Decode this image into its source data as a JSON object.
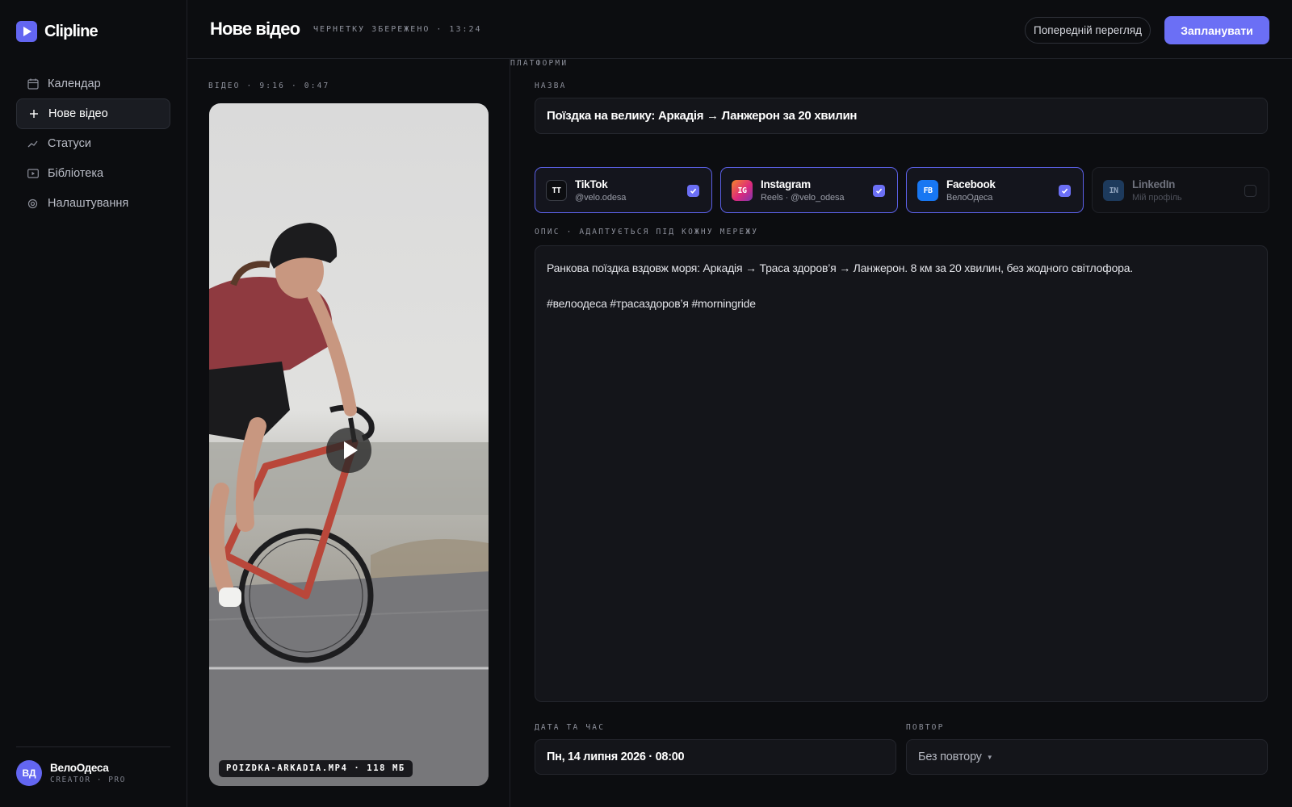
{
  "app": {
    "name": "Clipline"
  },
  "sidebar": {
    "items": [
      {
        "label": "Календар",
        "icon": "calendar-icon",
        "active": false
      },
      {
        "label": "Нове відео",
        "icon": "plus-icon",
        "active": true
      },
      {
        "label": "Статуси",
        "icon": "trend-line-icon",
        "active": false
      },
      {
        "label": "Бібліотека",
        "icon": "video-library-icon",
        "active": false
      },
      {
        "label": "Налаштування",
        "icon": "settings-target-icon",
        "active": false
      }
    ],
    "profile": {
      "initials": "ВД",
      "name": "ВелоОдеса",
      "plan": "CREATOR · PRO"
    }
  },
  "header": {
    "title": "Нове відео",
    "draft_status": "ЧЕРНЕТКУ ЗБЕРЕЖЕНО · 13:24",
    "preview_label": "Попередній перегляд",
    "schedule_label": "Запланувати"
  },
  "video": {
    "label": "ВІДЕО · 9:16 · 0:47",
    "filename": "POIZDKA-ARKADIA.MP4 · 118 МБ"
  },
  "form": {
    "title_label": "НАЗВА",
    "title_value": "Поїздка на велику: Аркадія → Ланжерон за 20 хвилин",
    "platforms_label": "ПЛАТФОРМИ",
    "platforms": [
      {
        "abbr": "TT",
        "name": "TikTok",
        "sub": "@velo.odesa",
        "checked": true,
        "color": "#0c0d10"
      },
      {
        "abbr": "IG",
        "name": "Instagram",
        "sub": "Reels · @velo_odesa",
        "checked": true,
        "color": "#e1306c"
      },
      {
        "abbr": "FB",
        "name": "Facebook",
        "sub": "ВелоОдеса",
        "checked": true,
        "color": "#1877f2"
      },
      {
        "abbr": "IN",
        "name": "LinkedIn",
        "sub": "Мій профіль",
        "checked": false,
        "color": "#1d3a5c"
      }
    ],
    "description_label": "ОПИС · АДАПТУЄТЬСЯ ПІД КОЖНУ МЕРЕЖУ",
    "description_line1": "Ранкова поїздка вздовж моря: Аркадія → Траса здоров’я → Ланжерон. 8 км за 20 хвилин, без жодного світлофора.",
    "description_line2": "#велоодеса #трасаздоров’я #morningride",
    "date_label": "ДАТА ТА ЧАС",
    "date_value": "Пн, 14 липня 2026 · 08:00",
    "repeat_label": "ПОВТОР",
    "repeat_value": "Без повтору"
  },
  "colors": {
    "accent": "#6b6ff5",
    "background": "#0c0d10",
    "panel": "#14151a"
  }
}
